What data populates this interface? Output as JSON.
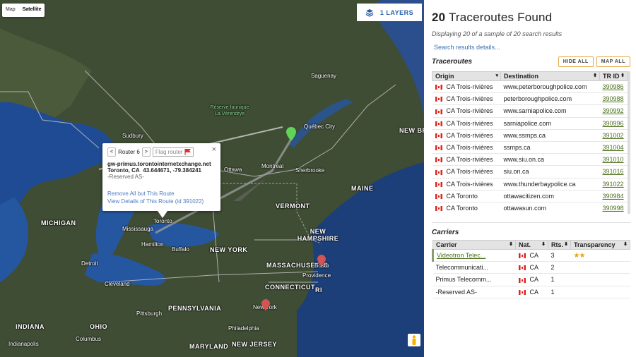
{
  "map": {
    "type_control": {
      "map_label": "Map",
      "satellite_label": "Satellite"
    },
    "layers_label": "1 LAYERS",
    "labels": {
      "saguenay": "Saguenay",
      "quebec_city": "Québec City",
      "new_brunswick": "NEW BRUNSWI",
      "reserve": "Réserve faunique La Vérendrye",
      "sudbury": "Sudbury",
      "ottawa": "Ottawa",
      "montreal": "Montreal",
      "sherbrooke": "Sherbrooke",
      "maine": "MAINE",
      "michigan": "MICHIGAN",
      "vermont": "VERMONT",
      "new_hampshire": "NEW HAMPSHIRE",
      "mississauga": "Mississauga",
      "toronto": "Toronto",
      "hamilton": "Hamilton",
      "buffalo": "Buffalo",
      "new_york_state": "NEW YORK",
      "massachusetts": "MASSACHUSETTS",
      "boston": "Bosto",
      "providence": "Providence",
      "connecticut": "CONNECTICUT",
      "ri": "RI",
      "detroit": "Detroit",
      "cleveland": "Cleveland",
      "pennsylvania": "PENNSYLVANIA",
      "new_york_city": "New York",
      "indiana": "INDIANA",
      "ohio": "OHIO",
      "indianapolis": "Indianapolis",
      "columbus": "Columbus",
      "philadelphia": "Philadelphia",
      "maryland": "MARYLAND",
      "new_jersey": "NEW JERSEY",
      "pittsburgh": "Pittsburgh"
    },
    "popup": {
      "title": "Router 6",
      "prev": "<",
      "next": ">",
      "flag_label": "Flag router",
      "close": "×",
      "hostname": "gw-primus.torontointernetxchange.net",
      "city": "Toronto, CA",
      "coords": "43.644671, -79.384241",
      "as_label": "-Reserved AS-",
      "link_remove": "Remove All but This Route",
      "link_view": "View Details of This Route (id 391022)"
    }
  },
  "panel": {
    "count": "20",
    "title": "Traceroutes Found",
    "subtitle": "Displaying 20 of a sample of 20 search results",
    "details_link": "Search results details...",
    "traceroutes_heading": "Traceroutes",
    "hide_all": "HIDE ALL",
    "map_all": "MAP ALL",
    "tr_headers": {
      "origin": "Origin",
      "destination": "Destination",
      "trid": "TR ID"
    },
    "traceroutes": [
      {
        "origin": "CA Trois-rivières",
        "destination": "www.peterboroughpolice.com",
        "trid": "390986"
      },
      {
        "origin": "CA Trois-rivières",
        "destination": "peterboroughpolice.com",
        "trid": "390988"
      },
      {
        "origin": "CA Trois-rivières",
        "destination": "www.sarniapolice.com",
        "trid": "390992"
      },
      {
        "origin": "CA Trois-rivières",
        "destination": "sarniapolice.com",
        "trid": "390996"
      },
      {
        "origin": "CA Trois-rivières",
        "destination": "www.ssmps.ca",
        "trid": "391002"
      },
      {
        "origin": "CA Trois-rivières",
        "destination": "ssmps.ca",
        "trid": "391004"
      },
      {
        "origin": "CA Trois-rivières",
        "destination": "www.siu.on.ca",
        "trid": "391010"
      },
      {
        "origin": "CA Trois-rivières",
        "destination": "siu.on.ca",
        "trid": "391016"
      },
      {
        "origin": "CA Trois-rivières",
        "destination": "www.thunderbaypolice.ca",
        "trid": "391022"
      },
      {
        "origin": "CA Toronto",
        "destination": "ottawacitizen.com",
        "trid": "390984"
      },
      {
        "origin": "CA Toronto",
        "destination": "ottawasun.com",
        "trid": "390998"
      }
    ],
    "carriers_heading": "Carriers",
    "carrier_headers": {
      "carrier": "Carrier",
      "nat": "Nat.",
      "rts": "Rts.",
      "transparency": "Transparency"
    },
    "carriers": [
      {
        "name": "Videotron Telec...",
        "nat": "CA",
        "rts": "3",
        "stars": "★★"
      },
      {
        "name": "Telecommunicati...",
        "nat": "CA",
        "rts": "2",
        "stars": ""
      },
      {
        "name": "Primus Telecomm...",
        "nat": "CA",
        "rts": "1",
        "stars": ""
      },
      {
        "name": "-Reserved AS-",
        "nat": "CA",
        "rts": "1",
        "stars": ""
      }
    ]
  }
}
